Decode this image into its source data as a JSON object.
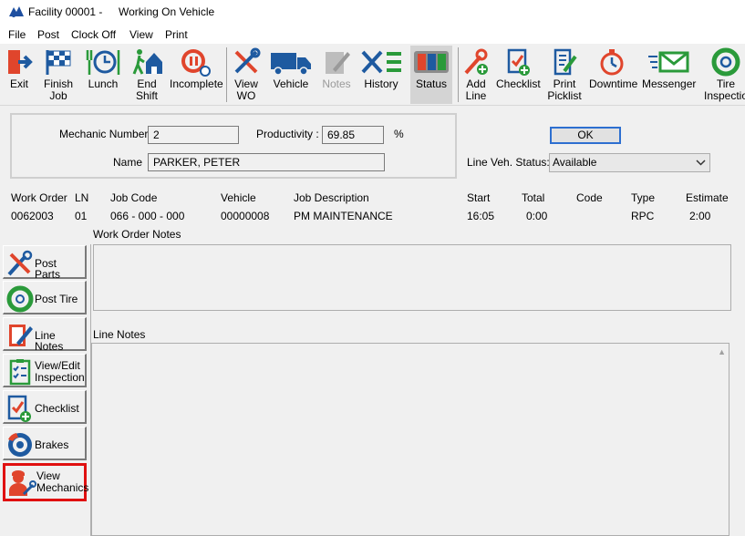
{
  "window": {
    "title": "Facility 00001 -",
    "subtitle": "Working On Vehicle"
  },
  "menu": [
    "File",
    "Post",
    "Clock Off",
    "View",
    "Print"
  ],
  "toolbar": {
    "exit": "Exit",
    "finish_job": [
      "Finish",
      "Job"
    ],
    "lunch": "Lunch",
    "end_shift": [
      "End",
      "Shift"
    ],
    "incomplete": "Incomplete",
    "view_wo": [
      "View",
      "WO"
    ],
    "vehicle": "Vehicle",
    "notes": "Notes",
    "history": "History",
    "status": "Status",
    "add_line": [
      "Add",
      "Line"
    ],
    "checklist": "Checklist",
    "print_picklist": [
      "Print",
      "Picklist"
    ],
    "downtime": "Downtime",
    "messenger": "Messenger",
    "tire_inspection": [
      "Tire",
      "Inspectio"
    ]
  },
  "mechanic": {
    "number_label": "Mechanic Number",
    "number_value": "2",
    "productivity_label": "Productivity :",
    "productivity_value": "69.85",
    "productivity_unit": "%",
    "name_label": "Name",
    "name_value": "PARKER, PETER"
  },
  "ok_label": "OK",
  "line_status": {
    "label": "Line Veh. Status:",
    "value": "Available"
  },
  "work_order_table": {
    "headers": {
      "work_order": "Work Order",
      "ln": "LN",
      "job_code": "Job Code",
      "vehicle": "Vehicle",
      "job_description": "Job Description",
      "start": "Start",
      "total": "Total",
      "code": "Code",
      "type": "Type",
      "estimate": "Estimate"
    },
    "row": {
      "work_order": "0062003",
      "ln": "01",
      "job_code": "066 - 000 - 000",
      "vehicle": "00000008",
      "job_description": "PM MAINTENANCE",
      "start": "16:05",
      "total": "0:00",
      "code": "",
      "type": "RPC",
      "estimate": "2:00"
    }
  },
  "work_order_notes_label": "Work Order Notes",
  "line_notes_label": "Line Notes",
  "sidebar": {
    "post_parts": "Post Parts",
    "post_tire": "Post Tire",
    "line_notes": "Line Notes",
    "view_edit_inspection": [
      "View/Edit",
      "Inspection"
    ],
    "checklist": "Checklist",
    "brakes": "Brakes",
    "view_mechanics": [
      "View",
      "Mechanics"
    ]
  },
  "colors": {
    "highlight_border": "#e01010",
    "ok_border": "#2d6fd0",
    "icon_blue": "#1e5aa0",
    "icon_red": "#e0452c",
    "icon_green": "#2a9a3a"
  }
}
